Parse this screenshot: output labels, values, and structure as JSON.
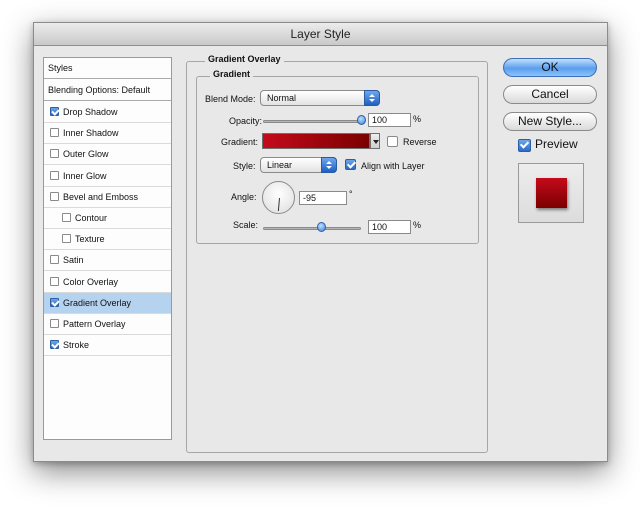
{
  "window": {
    "title": "Layer Style"
  },
  "styles_list": {
    "header": "Styles",
    "blending_options": "Blending Options: Default",
    "items": [
      {
        "label": "Drop Shadow",
        "checked": true,
        "indent": false,
        "selected": false
      },
      {
        "label": "Inner Shadow",
        "checked": false,
        "indent": false,
        "selected": false
      },
      {
        "label": "Outer Glow",
        "checked": false,
        "indent": false,
        "selected": false
      },
      {
        "label": "Inner Glow",
        "checked": false,
        "indent": false,
        "selected": false
      },
      {
        "label": "Bevel and Emboss",
        "checked": false,
        "indent": false,
        "selected": false
      },
      {
        "label": "Contour",
        "checked": false,
        "indent": true,
        "selected": false
      },
      {
        "label": "Texture",
        "checked": false,
        "indent": true,
        "selected": false
      },
      {
        "label": "Satin",
        "checked": false,
        "indent": false,
        "selected": false
      },
      {
        "label": "Color Overlay",
        "checked": false,
        "indent": false,
        "selected": false
      },
      {
        "label": "Gradient Overlay",
        "checked": true,
        "indent": false,
        "selected": true
      },
      {
        "label": "Pattern Overlay",
        "checked": false,
        "indent": false,
        "selected": false
      },
      {
        "label": "Stroke",
        "checked": true,
        "indent": false,
        "selected": false
      }
    ]
  },
  "panel": {
    "group_title": "Gradient Overlay",
    "inner_title": "Gradient",
    "blend_mode": {
      "label": "Blend Mode:",
      "value": "Normal"
    },
    "opacity": {
      "label": "Opacity:",
      "value": "100",
      "unit": "%",
      "level": 1.0
    },
    "gradient": {
      "label": "Gradient:",
      "color_start": "#c40a1c",
      "color_end": "#7a0000"
    },
    "reverse": {
      "label": "Reverse",
      "checked": false
    },
    "style": {
      "label": "Style:",
      "value": "Linear"
    },
    "align_with_layer": {
      "label": "Align with Layer",
      "checked": true
    },
    "angle": {
      "label": "Angle:",
      "value": "-95",
      "unit": "°"
    },
    "scale": {
      "label": "Scale:",
      "value": "100",
      "unit": "%",
      "level": 0.6
    }
  },
  "buttons": {
    "ok": "OK",
    "cancel": "Cancel",
    "new_style": "New Style...",
    "preview_label": "Preview",
    "preview_checked": true
  },
  "colors": {
    "accent_blue": "#5b9eec",
    "selection": "#b5d2ef",
    "preview_red": "#a30012"
  }
}
